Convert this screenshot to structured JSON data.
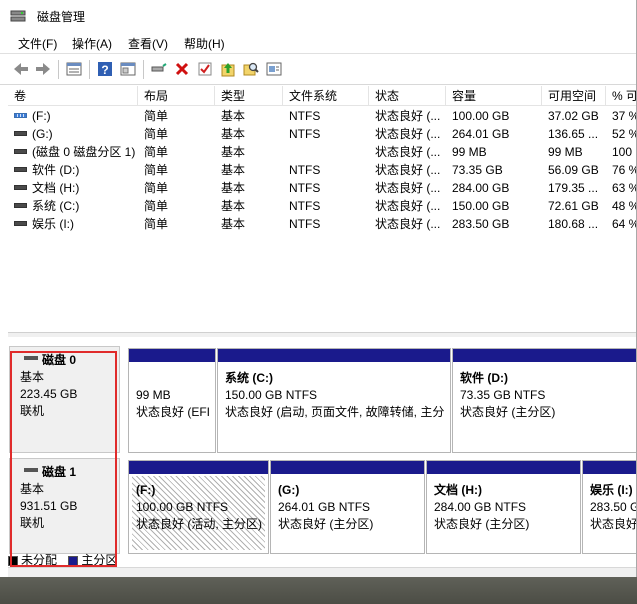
{
  "window": {
    "title": "磁盘管理"
  },
  "menu": [
    "文件(F)",
    "操作(A)",
    "查看(V)",
    "帮助(H)"
  ],
  "toolbar": [
    "back-arrow-icon",
    "forward-arrow-icon",
    "list-view-icon",
    "help-icon",
    "properties-icon",
    "connect-icon",
    "delete-x-icon",
    "check-icon",
    "up-arrow-icon",
    "search-icon",
    "console-icon"
  ],
  "volume_list": {
    "headers": [
      "卷",
      "布局",
      "类型",
      "文件系统",
      "状态",
      "容量",
      "可用空间",
      "% 可"
    ],
    "rows": [
      {
        "vol": "(F:)",
        "layout": "简单",
        "type": "基本",
        "fs": "NTFS",
        "status": "状态良好 (...",
        "capacity": "100.00 GB",
        "free": "37.02 GB",
        "pct": "37 %",
        "icon": "blue"
      },
      {
        "vol": "(G:)",
        "layout": "简单",
        "type": "基本",
        "fs": "NTFS",
        "status": "状态良好 (...",
        "capacity": "264.01 GB",
        "free": "136.65 ...",
        "pct": "52 %",
        "icon": "dark"
      },
      {
        "vol": "(磁盘 0 磁盘分区 1)",
        "layout": "简单",
        "type": "基本",
        "fs": "",
        "status": "状态良好 (...",
        "capacity": "99 MB",
        "free": "99 MB",
        "pct": "100",
        "icon": "dark"
      },
      {
        "vol": "软件 (D:)",
        "layout": "简单",
        "type": "基本",
        "fs": "NTFS",
        "status": "状态良好 (...",
        "capacity": "73.35 GB",
        "free": "56.09 GB",
        "pct": "76 %",
        "icon": "dark"
      },
      {
        "vol": "文档 (H:)",
        "layout": "简单",
        "type": "基本",
        "fs": "NTFS",
        "status": "状态良好 (...",
        "capacity": "284.00 GB",
        "free": "179.35 ...",
        "pct": "63 %",
        "icon": "dark"
      },
      {
        "vol": "系统 (C:)",
        "layout": "简单",
        "type": "基本",
        "fs": "NTFS",
        "status": "状态良好 (...",
        "capacity": "150.00 GB",
        "free": "72.61 GB",
        "pct": "48 %",
        "icon": "dark"
      },
      {
        "vol": "娱乐 (I:)",
        "layout": "简单",
        "type": "基本",
        "fs": "NTFS",
        "status": "状态良好 (...",
        "capacity": "283.50 GB",
        "free": "180.68 ...",
        "pct": "64 %",
        "icon": "dark"
      }
    ]
  },
  "disks": [
    {
      "name": "磁盘 0",
      "type": "基本",
      "size": "223.45 GB",
      "state": "联机",
      "partitions": [
        {
          "name": "",
          "size": "99 MB",
          "status": "状态良好 (EFI"
        },
        {
          "name": "系统 (C:)",
          "size": "150.00 GB NTFS",
          "status": "状态良好 (启动, 页面文件, 故障转储, 主分"
        },
        {
          "name": "软件 (D:)",
          "size": "73.35 GB NTFS",
          "status": "状态良好 (主分区)"
        }
      ]
    },
    {
      "name": "磁盘 1",
      "type": "基本",
      "size": "931.51 GB",
      "state": "联机",
      "partitions": [
        {
          "name": "(F:)",
          "size": "100.00 GB NTFS",
          "status": "状态良好 (活动, 主分区)"
        },
        {
          "name": "(G:)",
          "size": "264.01 GB NTFS",
          "status": "状态良好 (主分区)"
        },
        {
          "name": "文档 (H:)",
          "size": "284.00 GB NTFS",
          "status": "状态良好 (主分区)"
        },
        {
          "name": "娱乐 (I:)",
          "size": "283.50 GB",
          "status": "状态良好 ("
        }
      ]
    }
  ],
  "legend": [
    {
      "label": "未分配",
      "color": "#000000"
    },
    {
      "label": "主分区",
      "color": "#1a1a8c"
    }
  ]
}
